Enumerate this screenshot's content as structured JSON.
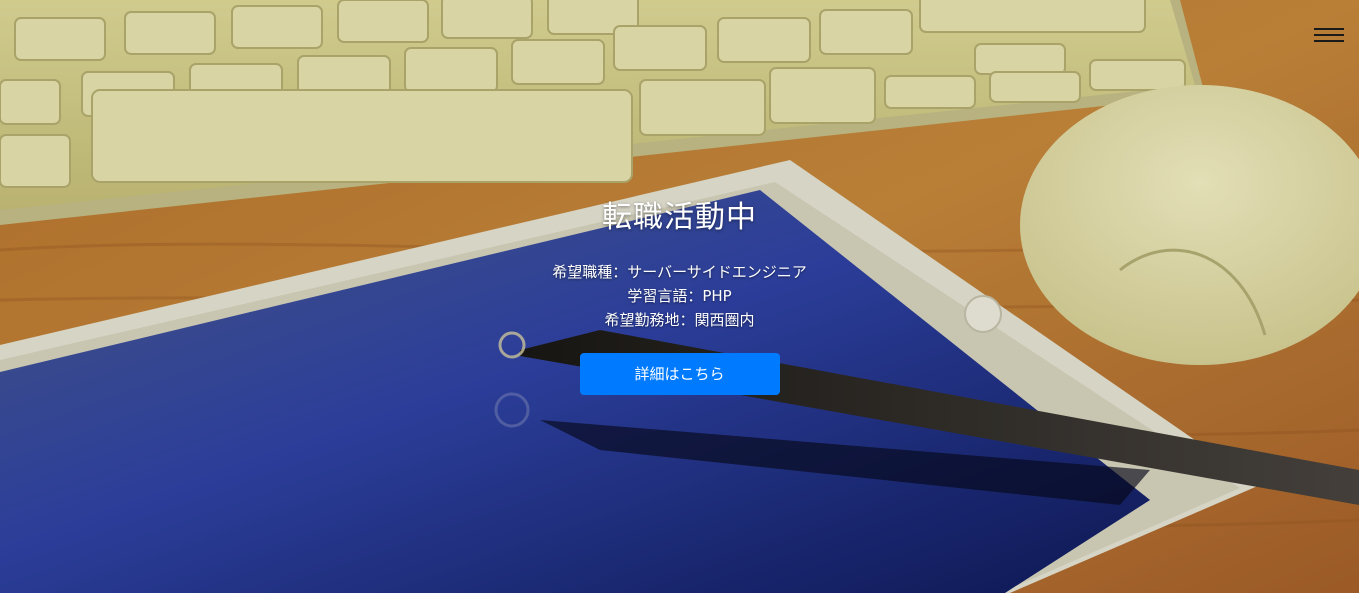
{
  "page": {
    "title": "転職活動中",
    "lines": [
      "希望職種：サーバーサイドエンジニア",
      "学習言語：PHP",
      "希望勤務地：関西圏内"
    ],
    "cta_label": "詳細はこちら"
  },
  "nav": {
    "menu_icon": "hamburger-menu-icon"
  },
  "colors": {
    "cta_background": "#007bff",
    "text": "#ffffff"
  }
}
